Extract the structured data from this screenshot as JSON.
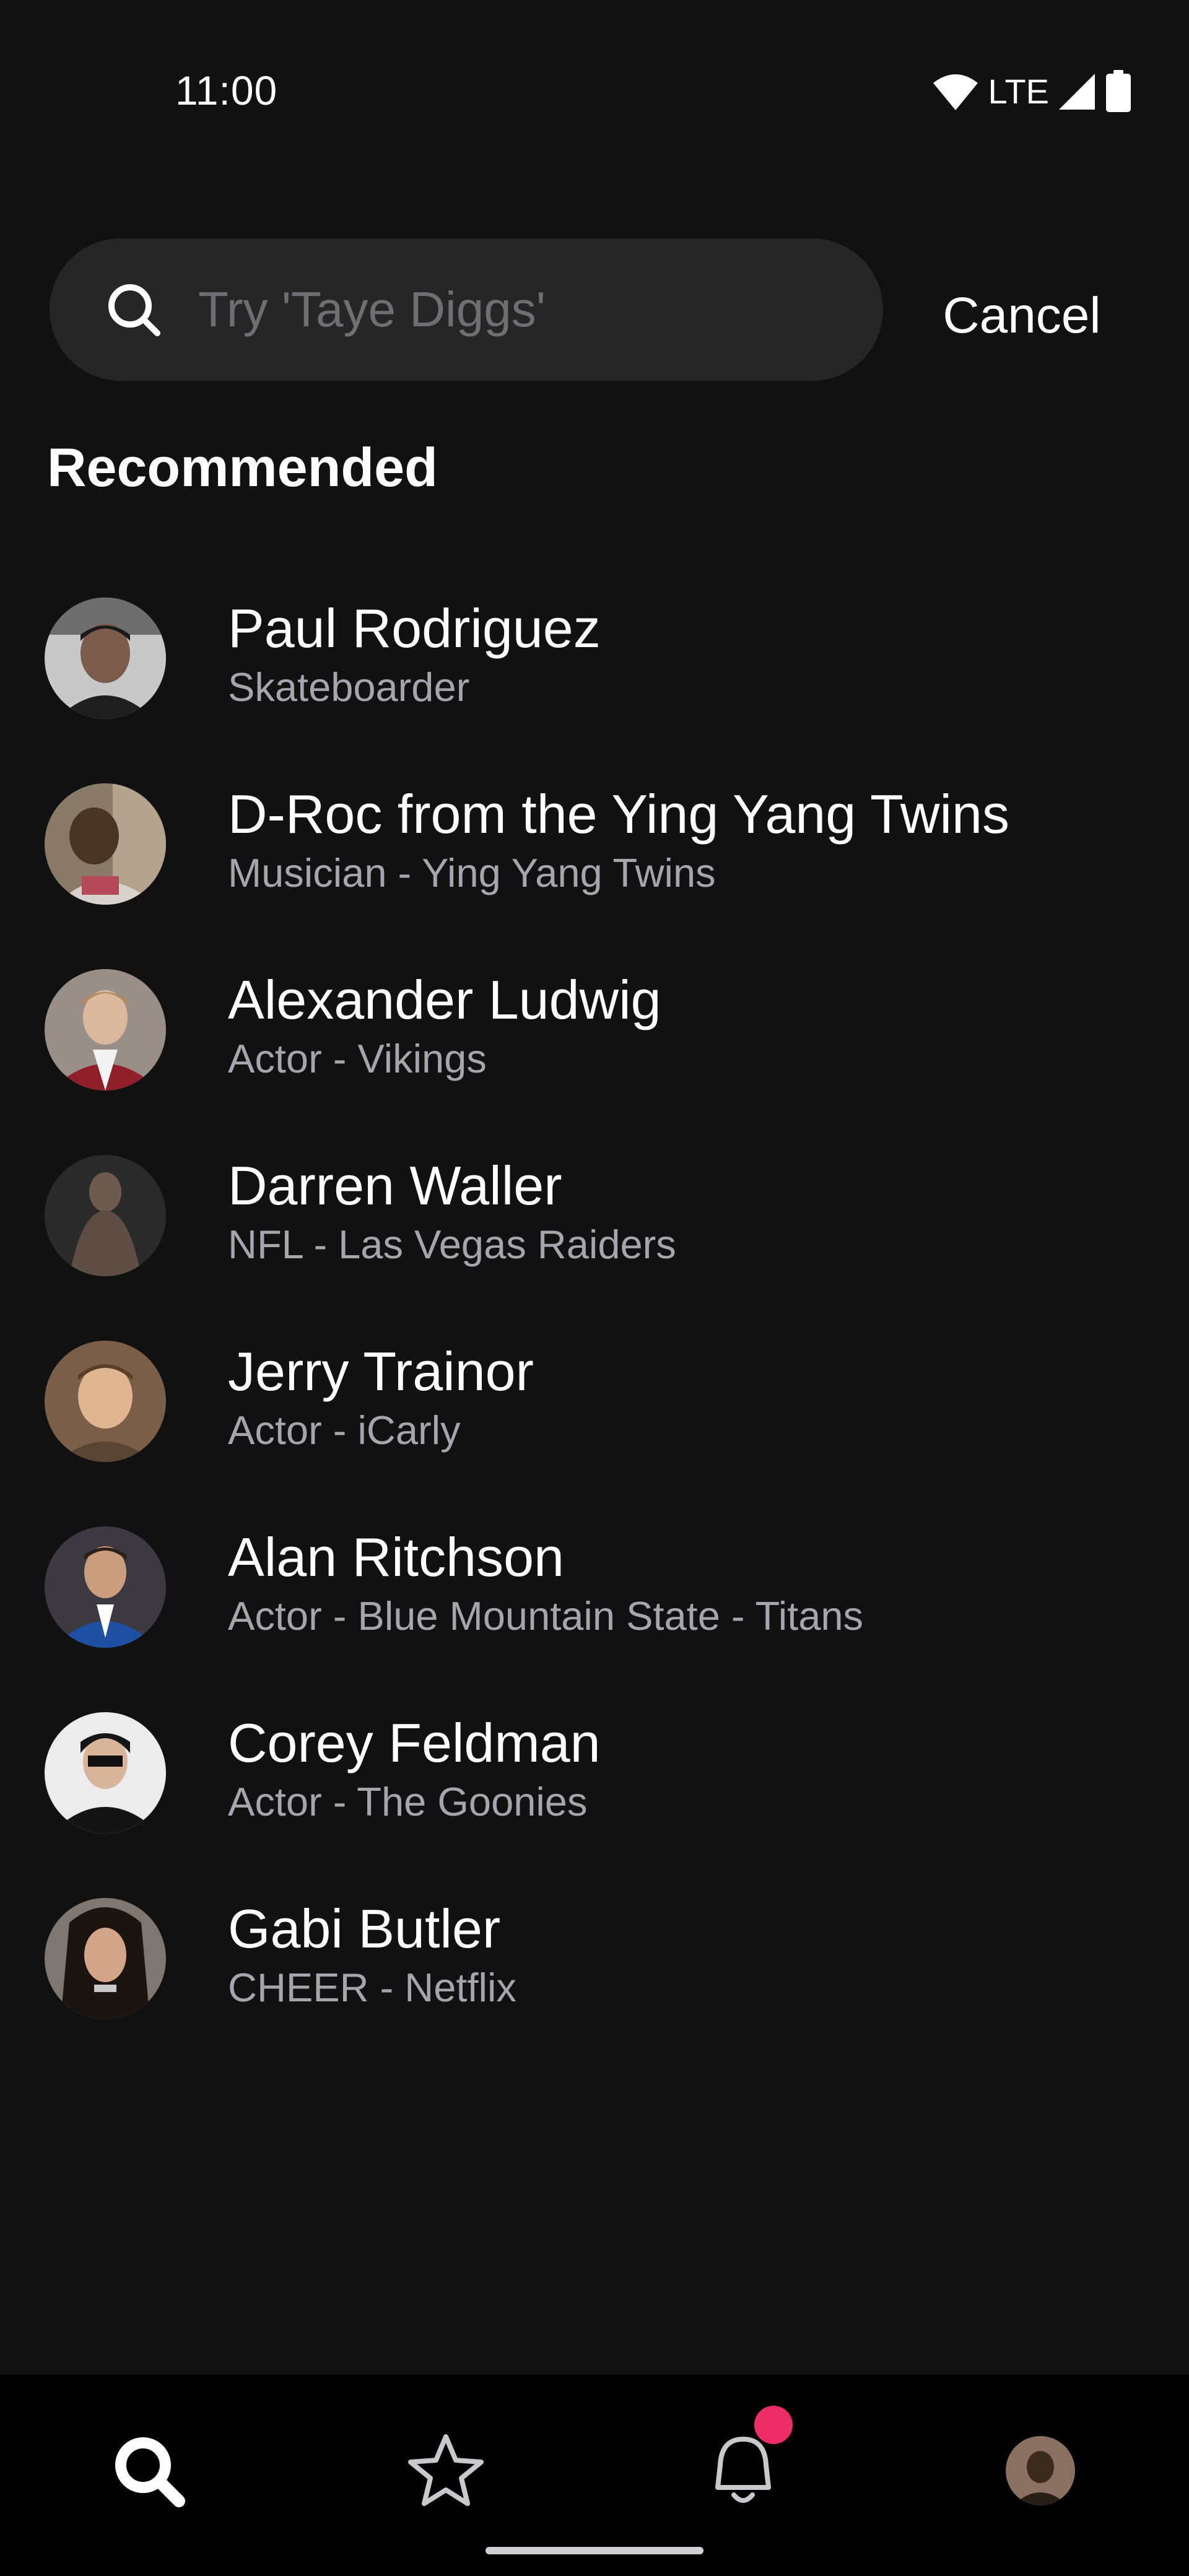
{
  "status_bar": {
    "time": "11:00",
    "network": "LTE",
    "icons": [
      "wifi-icon",
      "cell-signal-icon",
      "battery-icon"
    ]
  },
  "search": {
    "placeholder": "Try 'Taye Diggs'",
    "value": "",
    "cancel_label": "Cancel"
  },
  "recommended": {
    "heading": "Recommended",
    "items": [
      {
        "name": "Paul Rodriguez",
        "subtitle": "Skateboarder"
      },
      {
        "name": "D-Roc from the Ying Yang Twins",
        "subtitle": "Musician - Ying Yang Twins"
      },
      {
        "name": "Alexander Ludwig",
        "subtitle": "Actor - Vikings"
      },
      {
        "name": "Darren Waller",
        "subtitle": "NFL - Las Vegas Raiders"
      },
      {
        "name": "Jerry Trainor",
        "subtitle": "Actor - iCarly"
      },
      {
        "name": "Alan Ritchson",
        "subtitle": "Actor - Blue Mountain State - Titans"
      },
      {
        "name": "Corey Feldman",
        "subtitle": "Actor - The Goonies"
      },
      {
        "name": "Gabi Butler",
        "subtitle": "CHEER - Netflix"
      }
    ]
  },
  "bottom_nav": {
    "items": [
      "search-icon",
      "star-icon",
      "bell-icon",
      "profile-avatar"
    ],
    "active": "search-icon",
    "has_notification_badge": true
  },
  "colors": {
    "background": "#111112",
    "search_field": "#262627",
    "subtitle_text": "#a5a5ab",
    "nav_background": "#000000",
    "notification_badge": "#ee2d67"
  }
}
